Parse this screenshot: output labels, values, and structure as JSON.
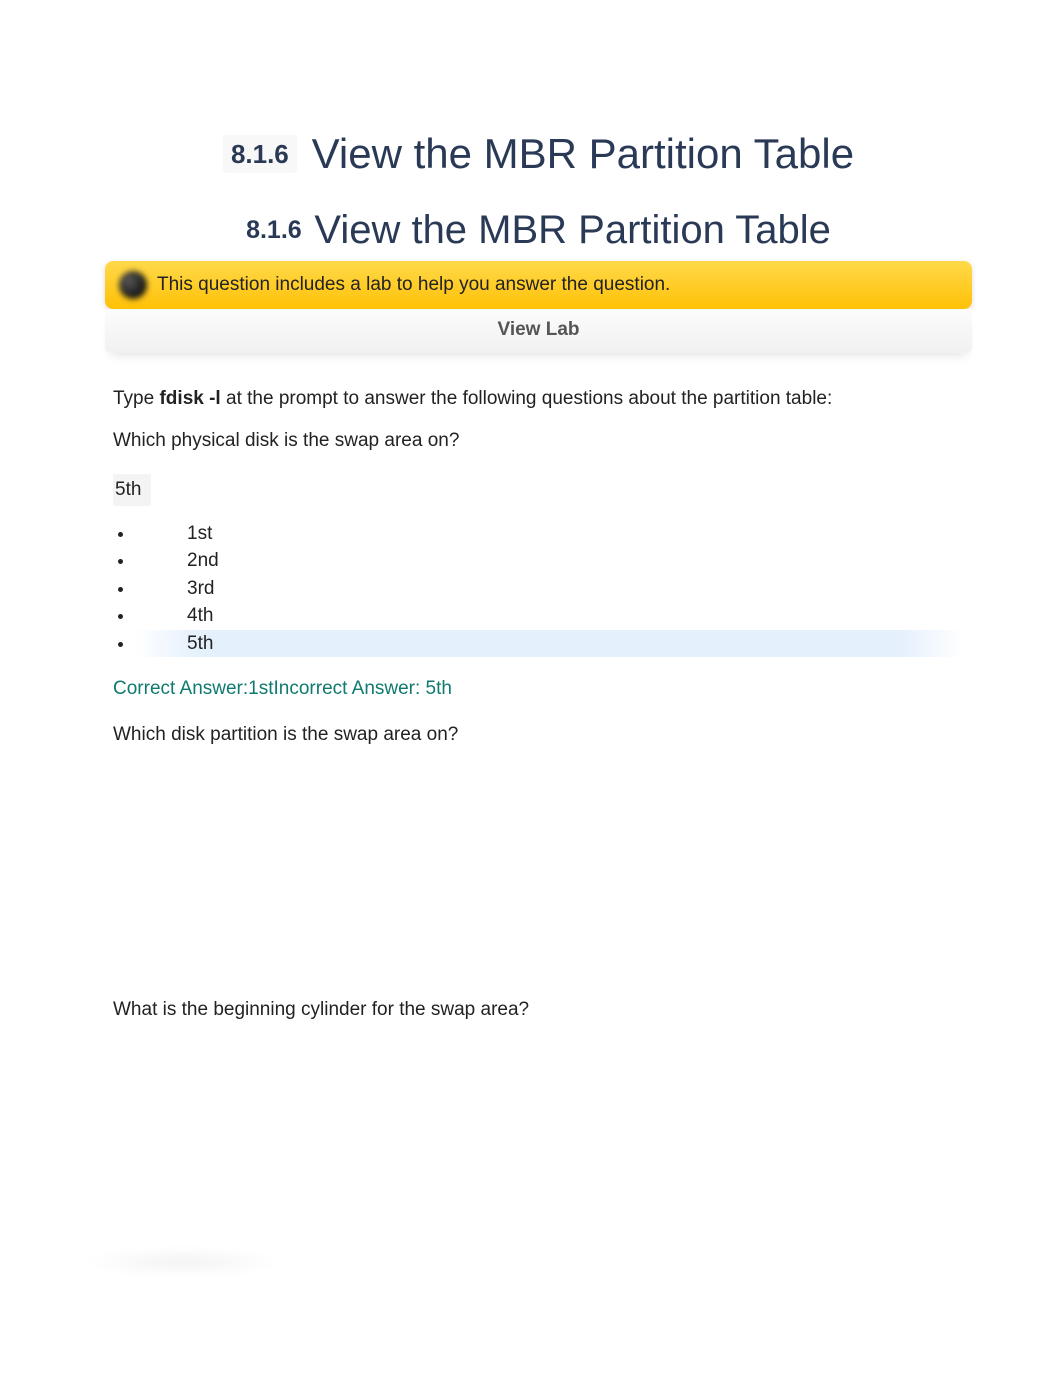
{
  "header": {
    "section_number": "8.1.6",
    "title": "View the MBR Partition Table",
    "subtitle_number": "8.1.6",
    "subtitle": "View the MBR Partition Table"
  },
  "lab_notice": {
    "message": "This question includes a lab to help you answer the question.",
    "button_label": "View Lab"
  },
  "instruction": {
    "prefix": "Type ",
    "command": "fdisk -l",
    "suffix": " at the prompt to answer the following questions about the partition table:"
  },
  "question1": {
    "text": "Which physical disk is the swap area on?",
    "selected": "5th",
    "options": [
      "1st",
      "2nd",
      "3rd",
      "4th",
      "5th"
    ],
    "highlight_index": 4,
    "feedback": "Correct Answer:1stIncorrect Answer: 5th"
  },
  "question2": {
    "text": "Which disk partition is the swap area on?"
  },
  "question3": {
    "text": "What is the beginning cylinder for the swap area?"
  }
}
